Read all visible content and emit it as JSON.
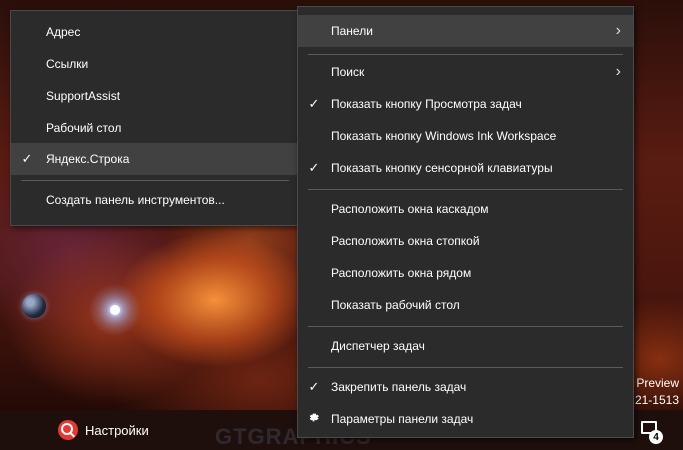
{
  "taskbar": {
    "search_label": "Настройки",
    "watermark": "GTGRAPHICS",
    "notification_count": "4",
    "build_line1": "Preview",
    "build_line2": "21-1513"
  },
  "left_menu": {
    "items": [
      {
        "label": "Адрес",
        "checked": false
      },
      {
        "label": "Ссылки",
        "checked": false
      },
      {
        "label": "SupportAssist",
        "checked": false
      },
      {
        "label": "Рабочий стол",
        "checked": false
      },
      {
        "label": "Яндекс.Строка",
        "checked": true
      }
    ],
    "create_toolbar": "Создать панель инструментов..."
  },
  "right_menu": {
    "panels": "Панели",
    "search": "Поиск",
    "show_task_view": "Показать кнопку Просмотра задач",
    "show_ink": "Показать кнопку Windows Ink Workspace",
    "show_keyboard": "Показать кнопку сенсорной клавиатуры",
    "cascade": "Расположить окна каскадом",
    "stack": "Расположить окна стопкой",
    "side_by_side": "Расположить окна рядом",
    "show_desktop": "Показать рабочий стол",
    "task_manager": "Диспетчер задач",
    "lock_taskbar": "Закрепить панель задач",
    "taskbar_settings": "Параметры панели задач"
  },
  "glyphs": {
    "check": "✓",
    "chevron": "›"
  }
}
